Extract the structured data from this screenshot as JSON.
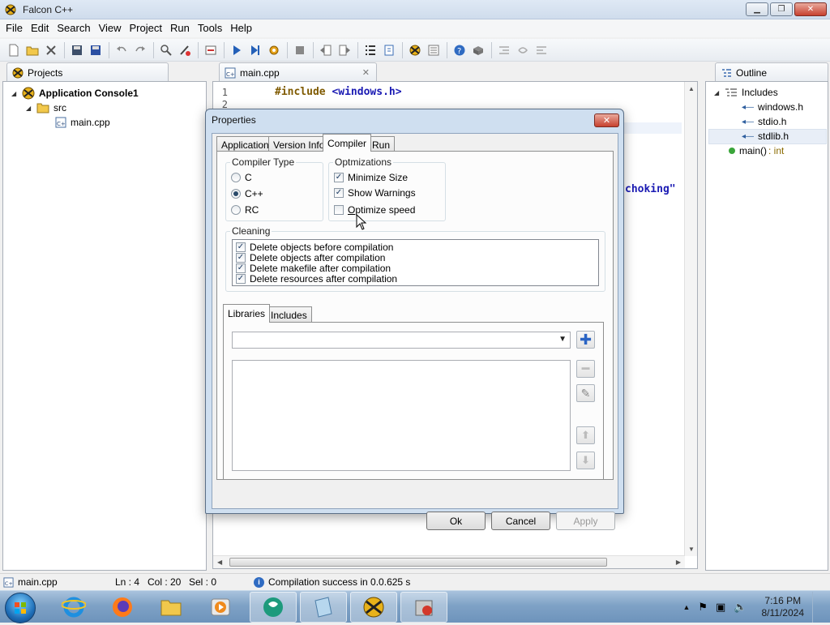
{
  "window": {
    "title": "Falcon C++"
  },
  "menu": [
    "File",
    "Edit",
    "Search",
    "View",
    "Project",
    "Run",
    "Tools",
    "Help"
  ],
  "toolbar_icons": [
    "new-file-icon",
    "open-folder-icon",
    "close-icon",
    "save-icon",
    "save-all-icon",
    "undo-icon",
    "redo-icon",
    "find-icon",
    "replace-icon",
    "collapse-icon",
    "run-icon",
    "step-icon",
    "build-icon",
    "stop-icon",
    "back-icon",
    "forward-icon",
    "list-icon",
    "bookmark-icon",
    "falcon-icon",
    "properties-icon",
    "help-icon",
    "package-icon",
    "indent-icon",
    "wrap-icon",
    "unindent-icon"
  ],
  "projects": {
    "tab_label": "Projects",
    "tree": {
      "root": "Application Console1",
      "folder": "src",
      "file": "main.cpp"
    }
  },
  "editor": {
    "tab_label": "main.cpp",
    "line_numbers": [
      "1",
      "2"
    ],
    "line1_keyword": "#include",
    "line1_header": "<windows.h>",
    "partial_text": "choking\""
  },
  "outline": {
    "tab_label": "Outline",
    "includes_label": "Includes",
    "includes": [
      "windows.h",
      "stdio.h",
      "stdlib.h"
    ],
    "function_name": "main()",
    "function_type": ": int"
  },
  "statusbar": {
    "file": "main.cpp",
    "line": "Ln : 4",
    "col": "Col : 20",
    "sel": "Sel : 0",
    "message": "Compilation success in 0.0.625 s"
  },
  "taskbar": {
    "time": "7:16 PM",
    "date": "8/11/2024"
  },
  "dialog": {
    "title": "Properties",
    "tabs": [
      "Application",
      "Version Info",
      "Compiler",
      "Run"
    ],
    "selected_tab": "Compiler",
    "compiler_type": {
      "label": "Compiler Type",
      "options": [
        "C",
        "C++",
        "RC"
      ],
      "selected": "C++"
    },
    "optimizations": {
      "label": "Optmizations",
      "minimize_size": "Minimize Size",
      "show_warnings": "Show Warnings",
      "optimize_speed_prefix": "O",
      "optimize_speed_rest": "ptimize speed"
    },
    "cleaning": {
      "label": "Cleaning",
      "items": [
        "Delete objects before compilation",
        "Delete objects after compilation",
        "Delete makefile after compilation",
        "Delete resources after compilation"
      ]
    },
    "inner_tabs": [
      "Libraries",
      "Includes"
    ],
    "buttons": {
      "ok": "Ok",
      "cancel": "Cancel",
      "apply": "Apply"
    }
  }
}
